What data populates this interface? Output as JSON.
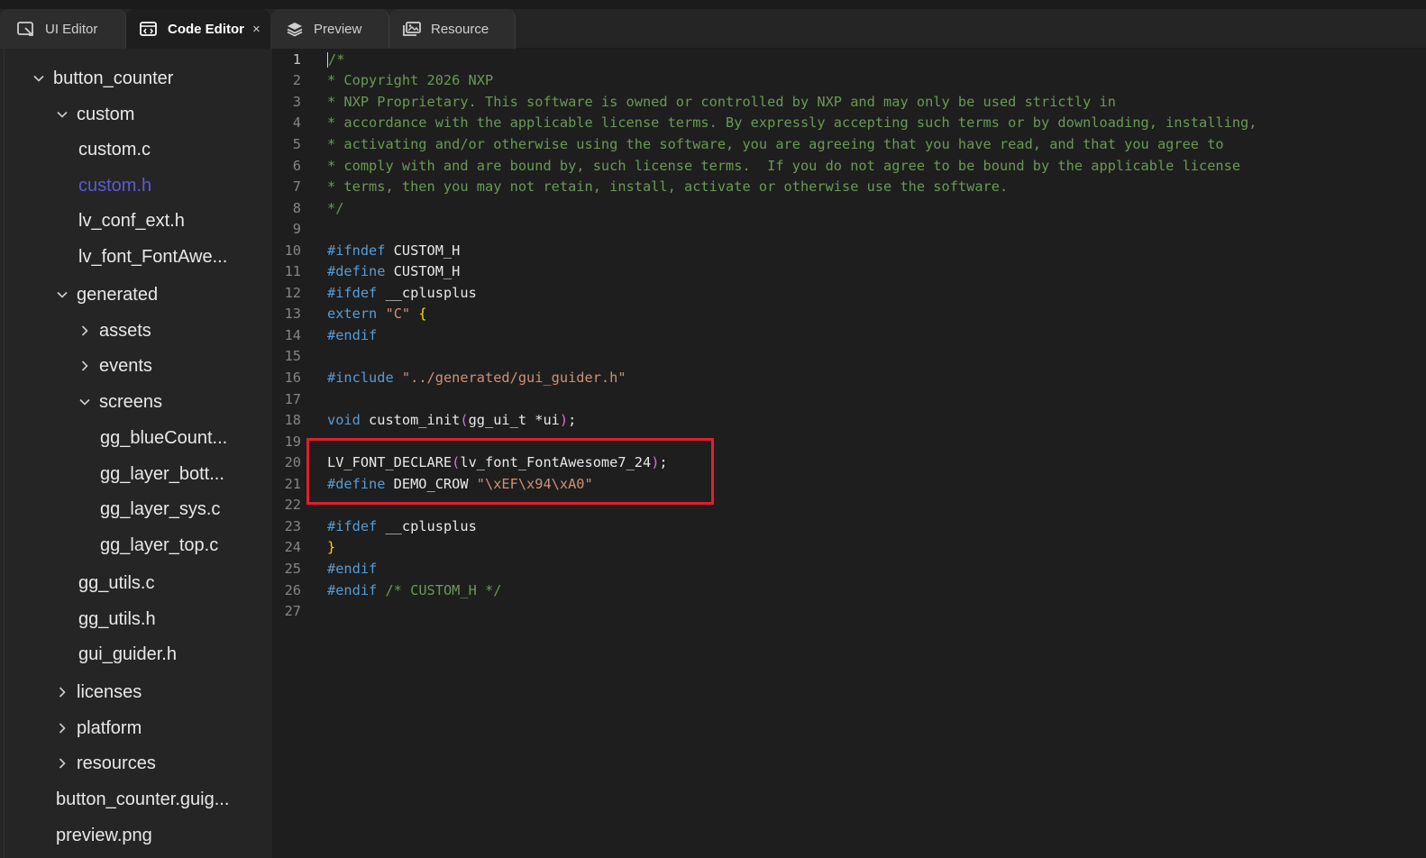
{
  "tabs": [
    {
      "label": "UI Editor",
      "icon": "ui-editor-icon"
    },
    {
      "label": "Code Editor",
      "icon": "code-editor-icon",
      "active": true,
      "close": "×"
    },
    {
      "label": "Preview",
      "icon": "layers-icon"
    },
    {
      "label": "Resource",
      "icon": "images-icon"
    }
  ],
  "tree": [
    {
      "label": "button_counter",
      "chevron": "down"
    },
    {
      "label": "custom",
      "chevron": "down"
    },
    {
      "label": "custom.c"
    },
    {
      "label": "custom.h",
      "selected": true
    },
    {
      "label": "lv_conf_ext.h"
    },
    {
      "label": "lv_font_FontAwe..."
    },
    {
      "label": "generated",
      "chevron": "down"
    },
    {
      "label": "assets",
      "chevron": "right"
    },
    {
      "label": "events",
      "chevron": "right"
    },
    {
      "label": "screens",
      "chevron": "down"
    },
    {
      "label": "gg_blueCount..."
    },
    {
      "label": "gg_layer_bott..."
    },
    {
      "label": "gg_layer_sys.c"
    },
    {
      "label": "gg_layer_top.c"
    },
    {
      "label": "gg_utils.c"
    },
    {
      "label": "gg_utils.h"
    },
    {
      "label": "gui_guider.h"
    },
    {
      "label": "licenses",
      "chevron": "right"
    },
    {
      "label": "platform",
      "chevron": "right"
    },
    {
      "label": "resources",
      "chevron": "right"
    },
    {
      "label": "button_counter.guig..."
    },
    {
      "label": "preview.png"
    }
  ],
  "lines": [
    {
      "n": "1",
      "tokens": [
        {
          "t": "/*",
          "c": "comment"
        }
      ]
    },
    {
      "n": "2",
      "tokens": [
        {
          "t": "* Copyright 2026 NXP",
          "c": "comment"
        }
      ]
    },
    {
      "n": "3",
      "tokens": [
        {
          "t": "* NXP Proprietary. This software is owned or controlled by NXP and may only be used strictly in",
          "c": "comment"
        }
      ]
    },
    {
      "n": "4",
      "tokens": [
        {
          "t": "* accordance with the applicable license terms. By expressly accepting such terms or by downloading, installing,",
          "c": "comment"
        }
      ]
    },
    {
      "n": "5",
      "tokens": [
        {
          "t": "* activating and/or otherwise using the software, you are agreeing that you have read, and that you agree to",
          "c": "comment"
        }
      ]
    },
    {
      "n": "6",
      "tokens": [
        {
          "t": "* comply with and are bound by, such license terms.  If you do not agree to be bound by the applicable license",
          "c": "comment"
        }
      ]
    },
    {
      "n": "7",
      "tokens": [
        {
          "t": "* terms, then you may not retain, install, activate or otherwise use the software.",
          "c": "comment"
        }
      ]
    },
    {
      "n": "8",
      "tokens": [
        {
          "t": "*/",
          "c": "comment"
        }
      ]
    },
    {
      "n": "9",
      "tokens": []
    },
    {
      "n": "10",
      "tokens": [
        {
          "t": "#ifndef",
          "c": "kw"
        },
        {
          "t": " CUSTOM_H",
          "c": "id"
        }
      ]
    },
    {
      "n": "11",
      "tokens": [
        {
          "t": "#define",
          "c": "kw"
        },
        {
          "t": " CUSTOM_H",
          "c": "id"
        }
      ]
    },
    {
      "n": "12",
      "tokens": [
        {
          "t": "#ifdef",
          "c": "kw"
        },
        {
          "t": " __cplusplus",
          "c": "id"
        }
      ]
    },
    {
      "n": "13",
      "tokens": [
        {
          "t": "extern",
          "c": "kw"
        },
        {
          "t": " ",
          "c": "id"
        },
        {
          "t": "\"C\"",
          "c": "str"
        },
        {
          "t": " ",
          "c": "id"
        },
        {
          "t": "{",
          "c": "brace"
        }
      ]
    },
    {
      "n": "14",
      "tokens": [
        {
          "t": "#endif",
          "c": "kw"
        }
      ]
    },
    {
      "n": "15",
      "tokens": []
    },
    {
      "n": "16",
      "tokens": [
        {
          "t": "#include",
          "c": "kw"
        },
        {
          "t": " ",
          "c": "id"
        },
        {
          "t": "\"../generated/gui_guider.h\"",
          "c": "str"
        }
      ]
    },
    {
      "n": "17",
      "tokens": []
    },
    {
      "n": "18",
      "tokens": [
        {
          "t": "void",
          "c": "kw"
        },
        {
          "t": " custom_init",
          "c": "id"
        },
        {
          "t": "(",
          "c": "paren2"
        },
        {
          "t": "gg_ui_t *ui",
          "c": "id"
        },
        {
          "t": ")",
          "c": "paren2"
        },
        {
          "t": ";",
          "c": "id"
        }
      ]
    },
    {
      "n": "19",
      "tokens": []
    },
    {
      "n": "20",
      "tokens": [
        {
          "t": "LV_FONT_DECLARE",
          "c": "id"
        },
        {
          "t": "(",
          "c": "paren2"
        },
        {
          "t": "lv_font_FontAwesome7_24",
          "c": "id"
        },
        {
          "t": ")",
          "c": "paren2"
        },
        {
          "t": ";",
          "c": "id"
        }
      ]
    },
    {
      "n": "21",
      "tokens": [
        {
          "t": "#define",
          "c": "kw"
        },
        {
          "t": " DEMO_CROW ",
          "c": "id"
        },
        {
          "t": "\"\\xEF\\x94\\xA0\"",
          "c": "str"
        }
      ]
    },
    {
      "n": "22",
      "tokens": []
    },
    {
      "n": "23",
      "tokens": [
        {
          "t": "#ifdef",
          "c": "kw"
        },
        {
          "t": " __cplusplus",
          "c": "id"
        }
      ]
    },
    {
      "n": "24",
      "tokens": [
        {
          "t": "}",
          "c": "brace"
        }
      ]
    },
    {
      "n": "25",
      "tokens": [
        {
          "t": "#endif",
          "c": "kw"
        }
      ]
    },
    {
      "n": "26",
      "tokens": [
        {
          "t": "#endif",
          "c": "kw"
        },
        {
          "t": " /* CUSTOM_H */",
          "c": "comment"
        }
      ]
    },
    {
      "n": "27",
      "tokens": []
    }
  ],
  "colors": {
    "highlight_box": "#e31d2b",
    "selected_file": "#5b5bd6",
    "comment": "#6a9955",
    "keyword": "#569cd6",
    "string": "#ce9178"
  }
}
